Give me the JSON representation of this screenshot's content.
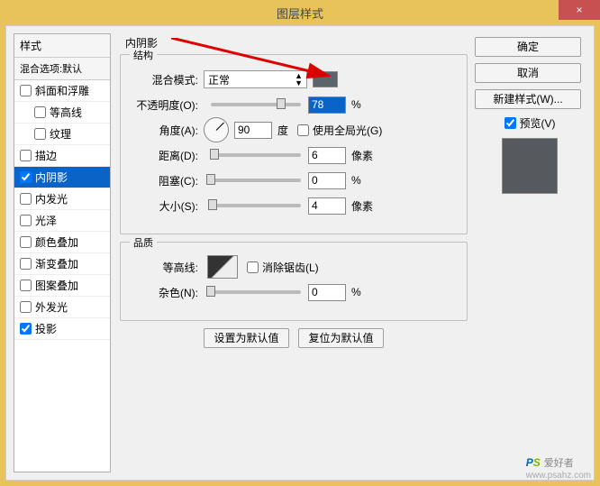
{
  "title": "图层样式",
  "close": "×",
  "styles": {
    "header": "样式",
    "sub": "混合选项:默认",
    "items": [
      {
        "label": "斜面和浮雕",
        "checked": false,
        "indent": 0
      },
      {
        "label": "等高线",
        "checked": false,
        "indent": 1
      },
      {
        "label": "纹理",
        "checked": false,
        "indent": 1
      },
      {
        "label": "描边",
        "checked": false,
        "indent": 0
      },
      {
        "label": "内阴影",
        "checked": true,
        "indent": 0,
        "selected": true
      },
      {
        "label": "内发光",
        "checked": false,
        "indent": 0
      },
      {
        "label": "光泽",
        "checked": false,
        "indent": 0
      },
      {
        "label": "颜色叠加",
        "checked": false,
        "indent": 0
      },
      {
        "label": "渐变叠加",
        "checked": false,
        "indent": 0
      },
      {
        "label": "图案叠加",
        "checked": false,
        "indent": 0
      },
      {
        "label": "外发光",
        "checked": false,
        "indent": 0
      },
      {
        "label": "投影",
        "checked": true,
        "indent": 0
      }
    ]
  },
  "main": {
    "title": "内阴影",
    "structure": {
      "label": "结构",
      "blend_mode_label": "混合模式:",
      "blend_mode_value": "正常",
      "opacity_label": "不透明度(O):",
      "opacity_value": "78",
      "opacity_unit": "%",
      "angle_label": "角度(A):",
      "angle_value": "90",
      "angle_unit": "度",
      "global_light": "使用全局光(G)",
      "distance_label": "距离(D):",
      "distance_value": "6",
      "distance_unit": "像素",
      "choke_label": "阻塞(C):",
      "choke_value": "0",
      "choke_unit": "%",
      "size_label": "大小(S):",
      "size_value": "4",
      "size_unit": "像素"
    },
    "quality": {
      "label": "品质",
      "contour_label": "等高线:",
      "antialias": "消除锯齿(L)",
      "noise_label": "杂色(N):",
      "noise_value": "0",
      "noise_unit": "%"
    },
    "buttons": {
      "default": "设置为默认值",
      "reset": "复位为默认值"
    }
  },
  "right": {
    "ok": "确定",
    "cancel": "取消",
    "new_style": "新建样式(W)...",
    "preview": "预览(V)"
  },
  "watermark": {
    "p": "P",
    "s": "S",
    "t": "爱好者",
    "u": "www.psahz.com"
  }
}
